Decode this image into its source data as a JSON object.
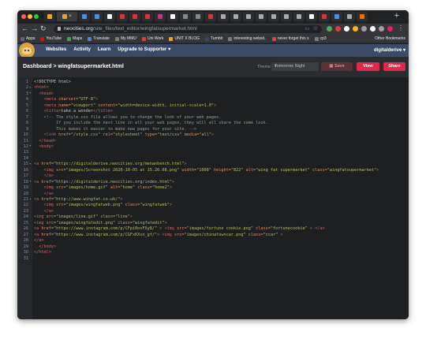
{
  "browser": {
    "url_host": "neocities.org",
    "url_path": "/site_files/text_editor/wingfatsupermarket.html",
    "bookmarks": [
      {
        "label": "Apps",
        "color": "#5f6368"
      },
      {
        "label": "YouTube",
        "color": "#ff0000"
      },
      {
        "label": "Maps",
        "color": "#34a853"
      },
      {
        "label": "Translate",
        "color": "#4285f4"
      },
      {
        "label": "My MMU",
        "color": "#7b7b7b"
      },
      {
        "label": "Uni Work",
        "color": "#e03c31"
      },
      {
        "label": "UNIT X BLOG",
        "color": "#f0a020"
      },
      {
        "label": "Tumblr",
        "color": "#35465c"
      },
      {
        "label": "interesting websit..",
        "color": "#7b7b7b"
      },
      {
        "label": "never forget this s",
        "color": "#e04040"
      },
      {
        "label": "cp3",
        "color": "#7b7b7b"
      }
    ],
    "other_bookmarks": "Other Bookmarks"
  },
  "neocities_nav": {
    "links": [
      "Websites",
      "Activity",
      "Learn",
      "Upgrade to Supporter ♥"
    ],
    "username": "digitalderive ▾"
  },
  "editor": {
    "breadcrumb": "Dashboard > wingfatsupermarket.html",
    "theme_label": "Theme",
    "theme_value": "Tomorrow Night",
    "save_label": "Save",
    "view_label": "View",
    "share_label": "Share",
    "colors": {
      "accent": "#e0284a",
      "tag": "#cc6666",
      "attr": "#de935f",
      "string": "#b5bd68",
      "text": "#c5c8c6",
      "comment": "#969896"
    }
  },
  "code_lines": [
    [
      {
        "t": "text",
        "v": "<!DOCTYPE html>"
      }
    ],
    [
      {
        "t": "tag",
        "v": "<html>"
      }
    ],
    [
      {
        "t": "text",
        "v": "  "
      },
      {
        "t": "tag",
        "v": "<head>"
      }
    ],
    [
      {
        "t": "text",
        "v": "    "
      },
      {
        "t": "tag",
        "v": "<meta "
      },
      {
        "t": "attr",
        "v": "charset="
      },
      {
        "t": "str",
        "v": "\"UTF-8\""
      },
      {
        "t": "tag",
        "v": ">"
      }
    ],
    [
      {
        "t": "text",
        "v": "    "
      },
      {
        "t": "tag",
        "v": "<meta "
      },
      {
        "t": "attr",
        "v": "name="
      },
      {
        "t": "str",
        "v": "\"viewport\""
      },
      {
        "t": "attr",
        "v": " content="
      },
      {
        "t": "str",
        "v": "\"width=device-width, initial-scale=1.0\""
      },
      {
        "t": "tag",
        "v": ">"
      }
    ],
    [
      {
        "t": "text",
        "v": "    "
      },
      {
        "t": "tag",
        "v": "<title>"
      },
      {
        "t": "text",
        "v": "take a wonder"
      },
      {
        "t": "tag",
        "v": "</title>"
      }
    ],
    [
      {
        "t": "text",
        "v": "    "
      },
      {
        "t": "com",
        "v": "<!-- The style.css file allows you to change the look of your web pages."
      }
    ],
    [
      {
        "t": "com",
        "v": "         If you include the next line in all your web pages, they will all share the same look."
      }
    ],
    [
      {
        "t": "com",
        "v": "         This makes it easier to make new pages for your site. -->"
      }
    ],
    [
      {
        "t": "text",
        "v": "    "
      },
      {
        "t": "tag",
        "v": "<link "
      },
      {
        "t": "attr",
        "v": "href="
      },
      {
        "t": "str",
        "v": "\"/style.css\""
      },
      {
        "t": "attr",
        "v": " rel="
      },
      {
        "t": "str",
        "v": "\"stylesheet\""
      },
      {
        "t": "attr",
        "v": " type="
      },
      {
        "t": "str",
        "v": "\"text/css\""
      },
      {
        "t": "attr",
        "v": " media="
      },
      {
        "t": "str",
        "v": "\"all\""
      },
      {
        "t": "tag",
        "v": ">"
      }
    ],
    [
      {
        "t": "text",
        "v": "  "
      },
      {
        "t": "tag",
        "v": "</head>"
      }
    ],
    [
      {
        "t": "text",
        "v": "  "
      },
      {
        "t": "tag",
        "v": "<body>"
      }
    ],
    [],
    [],
    [
      {
        "t": "tag",
        "v": "<a "
      },
      {
        "t": "attr",
        "v": "href="
      },
      {
        "t": "str",
        "v": "\"https://digitalderive.neocities.org/menanbench.html\""
      },
      {
        "t": "tag",
        "v": ">"
      }
    ],
    [
      {
        "t": "text",
        "v": "    "
      },
      {
        "t": "tag",
        "v": "<img "
      },
      {
        "t": "attr",
        "v": "src="
      },
      {
        "t": "str",
        "v": "\"images/Screenshot 2020-10-05 at 15.20.08.png\""
      },
      {
        "t": "attr",
        "v": " width="
      },
      {
        "t": "str",
        "v": "\"1008\""
      },
      {
        "t": "attr",
        "v": " height="
      },
      {
        "t": "str",
        "v": "\"822\""
      },
      {
        "t": "attr",
        "v": " alt="
      },
      {
        "t": "str",
        "v": "\"wing fat supermarket\""
      },
      {
        "t": "attr",
        "v": " class="
      },
      {
        "t": "str",
        "v": "\"wingfatsupermarket\""
      },
      {
        "t": "tag",
        "v": ">"
      }
    ],
    [
      {
        "t": "text",
        "v": "    "
      },
      {
        "t": "tag",
        "v": "</a>"
      }
    ],
    [
      {
        "t": "tag",
        "v": "<a "
      },
      {
        "t": "attr",
        "v": "href="
      },
      {
        "t": "str",
        "v": "\"https://digitalderive.neocities.org/index.html\""
      },
      {
        "t": "tag",
        "v": ">"
      }
    ],
    [
      {
        "t": "text",
        "v": "    "
      },
      {
        "t": "tag",
        "v": "<img "
      },
      {
        "t": "attr",
        "v": "src="
      },
      {
        "t": "str",
        "v": "\"images/home.gif\""
      },
      {
        "t": "attr",
        "v": " alt="
      },
      {
        "t": "str",
        "v": "\"home\""
      },
      {
        "t": "attr",
        "v": " class="
      },
      {
        "t": "str",
        "v": "\"home2\""
      },
      {
        "t": "tag",
        "v": ">"
      }
    ],
    [
      {
        "t": "text",
        "v": "    "
      },
      {
        "t": "tag",
        "v": "</a>"
      }
    ],
    [
      {
        "t": "tag",
        "v": "<a "
      },
      {
        "t": "attr",
        "v": "href="
      },
      {
        "t": "str",
        "v": "\"http://www.wingfat.co.uk/\""
      },
      {
        "t": "tag",
        "v": ">"
      }
    ],
    [
      {
        "t": "text",
        "v": "    "
      },
      {
        "t": "tag",
        "v": "<img "
      },
      {
        "t": "attr",
        "v": "src="
      },
      {
        "t": "str",
        "v": "\"images/wingfatweb.png\""
      },
      {
        "t": "attr",
        "v": " class="
      },
      {
        "t": "str",
        "v": "\"wingfatweb\""
      },
      {
        "t": "tag",
        "v": ">"
      }
    ],
    [
      {
        "t": "text",
        "v": "    "
      },
      {
        "t": "tag",
        "v": "</a>"
      }
    ],
    [
      {
        "t": "tag",
        "v": "<img "
      },
      {
        "t": "attr",
        "v": "src="
      },
      {
        "t": "str",
        "v": "\"images/line.gif\""
      },
      {
        "t": "attr",
        "v": " class="
      },
      {
        "t": "str",
        "v": "\"line\""
      },
      {
        "t": "tag",
        "v": ">"
      }
    ],
    [
      {
        "t": "tag",
        "v": "<img "
      },
      {
        "t": "attr",
        "v": "src="
      },
      {
        "t": "str",
        "v": "\"images/wingfatedit.png\""
      },
      {
        "t": "attr",
        "v": " class="
      },
      {
        "t": "str",
        "v": "\"wingfatedit\""
      },
      {
        "t": "tag",
        "v": ">"
      }
    ],
    [
      {
        "t": "tag",
        "v": "<a "
      },
      {
        "t": "attr",
        "v": "href="
      },
      {
        "t": "str",
        "v": "\"https://www.instagram.com/p/CFpi0osFXy8/\""
      },
      {
        "t": "tag",
        "v": " > <img "
      },
      {
        "t": "attr",
        "v": "src="
      },
      {
        "t": "str",
        "v": "\"images/fortune cookie.png\""
      },
      {
        "t": "attr",
        "v": " class="
      },
      {
        "t": "str",
        "v": "\"fortunecookie\""
      },
      {
        "t": "tag",
        "v": " > </a>"
      }
    ],
    [
      {
        "t": "tag",
        "v": "<a "
      },
      {
        "t": "attr",
        "v": "href="
      },
      {
        "t": "str",
        "v": "\"https://www.instagram.com/p/CGFxKXvn_gf/\""
      },
      {
        "t": "tag",
        "v": "> <img "
      },
      {
        "t": "attr",
        "v": "src="
      },
      {
        "t": "str",
        "v": "\"images/chinatowncar.png\""
      },
      {
        "t": "attr",
        "v": " class="
      },
      {
        "t": "str",
        "v": "\"ccar\""
      },
      {
        "t": "tag",
        "v": " >"
      }
    ],
    [
      {
        "t": "tag",
        "v": "</a>"
      }
    ],
    [
      {
        "t": "text",
        "v": "  "
      },
      {
        "t": "tag",
        "v": "</body>"
      }
    ],
    [
      {
        "t": "tag",
        "v": "</html>"
      }
    ],
    []
  ]
}
